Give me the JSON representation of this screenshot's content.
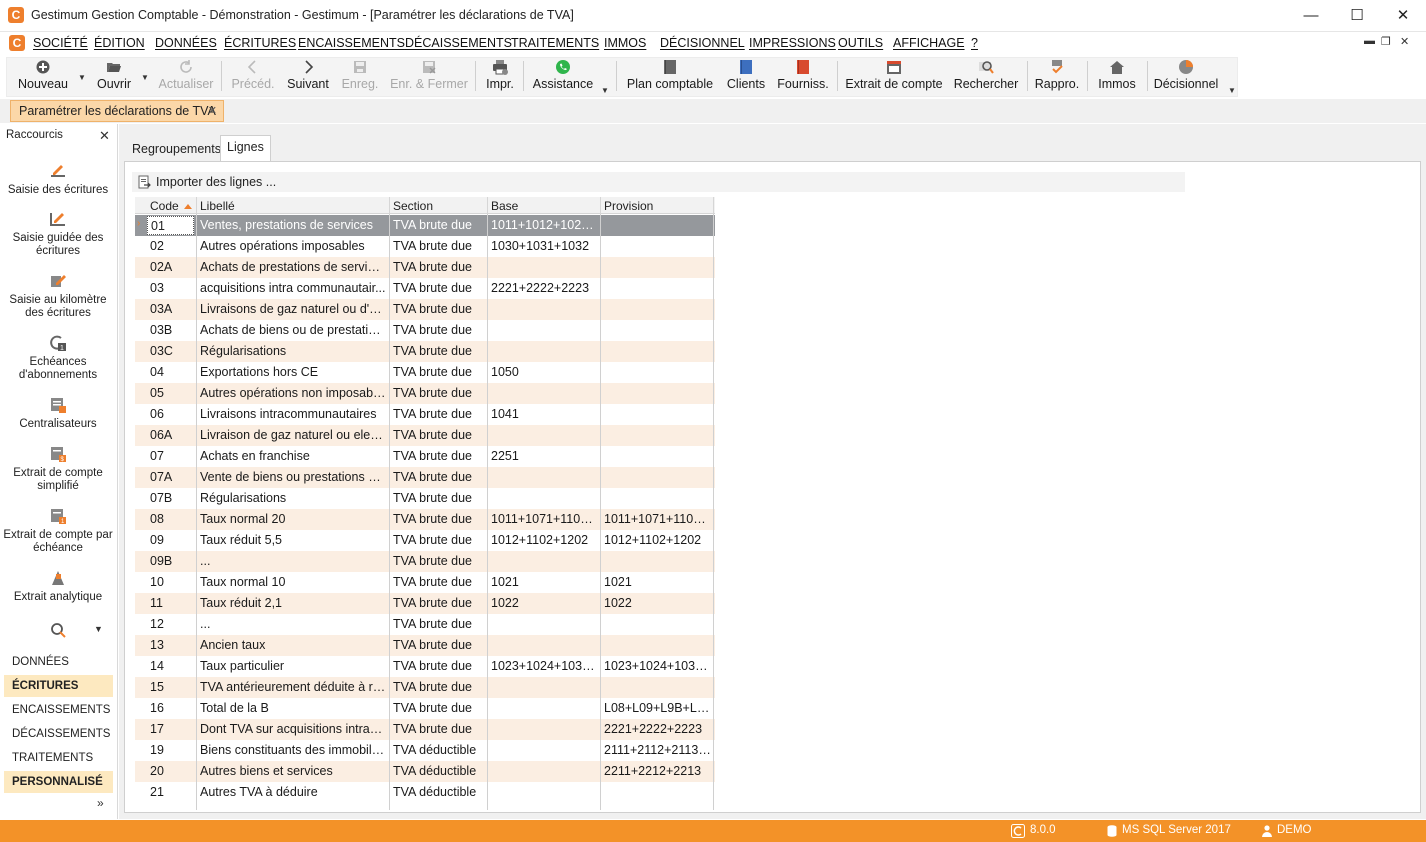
{
  "window": {
    "title": "Gestimum Gestion Comptable - Démonstration - Gestimum - [Paramétrer les déclarations de TVA]",
    "logo": "C",
    "minimize": "—",
    "maximize": "☐",
    "close": "✕"
  },
  "menu": {
    "items": [
      "SOCIÉTÉ",
      "ÉDITION",
      "DONNÉES",
      "ÉCRITURES",
      "ENCAISSEMENTS",
      "DÉCAISSEMENTS",
      "TRAITEMENTS",
      "IMMOS",
      "DÉCISIONNEL",
      "IMPRESSIONS",
      "OUTILS",
      "AFFICHAGE",
      "?"
    ],
    "mdi_minimize": "▬",
    "mdi_restore": "❐",
    "mdi_close": "✕"
  },
  "toolbar": {
    "nouveau": "Nouveau",
    "ouvrir": "Ouvrir",
    "actualiser": "Actualiser",
    "preced": "Précéd.",
    "suivant": "Suivant",
    "enreg": "Enreg.",
    "enr_fermer": "Enr. & Fermer",
    "impr": "Impr.",
    "assistance": "Assistance",
    "plan_comptable": "Plan comptable",
    "clients": "Clients",
    "fourniss": "Fourniss.",
    "extrait_compte": "Extrait de compte",
    "rechercher": "Rechercher",
    "rappro": "Rappro.",
    "immos": "Immos",
    "decisionnel": "Décisionnel"
  },
  "document_tab": {
    "label": "Paramétrer les déclarations de TVA",
    "close": "✕"
  },
  "sidebar": {
    "header": "Raccourcis",
    "close": "✕",
    "shortcuts": [
      "Saisie des écritures",
      "Saisie guidée des écritures",
      "Saisie au kilomètre des écritures",
      "Echéances d'abonnements",
      "Centralisateurs",
      "Extrait de compte simplifié",
      "Extrait de compte par échéance",
      "Extrait analytique"
    ],
    "nav": [
      "DONNÉES",
      "ÉCRITURES",
      "ENCAISSEMENTS",
      "DÉCAISSEMENTS",
      "TRAITEMENTS",
      "PERSONNALISÉ"
    ],
    "more": "»"
  },
  "tabs": {
    "regroupements": "Regroupements",
    "lignes": "Lignes"
  },
  "import_label": "Importer des lignes ...",
  "grid": {
    "columns": [
      "Code",
      "Libellé",
      "Section",
      "Base",
      "Provision"
    ],
    "rows": [
      [
        "01",
        "Ventes, prestations de services",
        "TVA brute due",
        "1011+1012+1021+...",
        ""
      ],
      [
        "02",
        "Autres opérations imposables",
        "TVA brute due",
        "1030+1031+1032",
        ""
      ],
      [
        "02A",
        "Achats de prestations de services ...",
        "TVA brute due",
        "",
        ""
      ],
      [
        "03",
        "acquisitions intra communautair...",
        "TVA brute due",
        "2221+2222+2223",
        ""
      ],
      [
        "03A",
        "Livraisons de gaz naturel ou d'éle...",
        "TVA brute due",
        "",
        ""
      ],
      [
        "03B",
        "Achats de biens ou de prestation...",
        "TVA brute due",
        "",
        ""
      ],
      [
        "03C",
        "Régularisations",
        "TVA brute due",
        "",
        ""
      ],
      [
        "04",
        "Exportations hors CE",
        "TVA brute due",
        "1050",
        ""
      ],
      [
        "05",
        "Autres opérations non imposables",
        "TVA brute due",
        "",
        ""
      ],
      [
        "06",
        "Livraisons intracommunautaires",
        "TVA brute due",
        "1041",
        ""
      ],
      [
        "06A",
        "Livraison de gaz naturel ou electri...",
        "TVA brute due",
        "",
        ""
      ],
      [
        "07",
        "Achats en franchise",
        "TVA brute due",
        "2251",
        ""
      ],
      [
        "07A",
        "Vente de biens ou prestations de ...",
        "TVA brute due",
        "",
        ""
      ],
      [
        "07B",
        "Régularisations",
        "TVA brute due",
        "",
        ""
      ],
      [
        "08",
        "Taux normal 20",
        "TVA brute due",
        "1011+1071+1101+...",
        "1011+1071+1101+..."
      ],
      [
        "09",
        "Taux réduit 5,5",
        "TVA brute due",
        "1012+1102+1202",
        "1012+1102+1202"
      ],
      [
        "09B",
        "...",
        "TVA brute due",
        "",
        ""
      ],
      [
        "10",
        "Taux normal 10",
        "TVA brute due",
        "1021",
        "1021"
      ],
      [
        "11",
        "Taux réduit 2,1",
        "TVA brute due",
        "1022",
        "1022"
      ],
      [
        "12",
        "...",
        "TVA brute due",
        "",
        ""
      ],
      [
        "13",
        "Ancien taux",
        "TVA brute due",
        "",
        ""
      ],
      [
        "14",
        "Taux particulier",
        "TVA brute due",
        "1023+1024+1031+...",
        "1023+1024+1031+..."
      ],
      [
        "15",
        "TVA antérieurement déduite à rev...",
        "TVA brute due",
        "",
        ""
      ],
      [
        "16",
        "Total de la B",
        "TVA brute due",
        "",
        "L08+L09+L9B+L1..."
      ],
      [
        "17",
        "Dont TVA sur acquisitions intraco...",
        "TVA brute due",
        "",
        "2221+2222+2223"
      ],
      [
        "19",
        "Biens constituants des immobilis...",
        "TVA déductible",
        "",
        "2111+2112+2113+..."
      ],
      [
        "20",
        "Autres biens et services",
        "TVA déductible",
        "",
        "2211+2212+2213"
      ],
      [
        "21",
        "Autres TVA à déduire",
        "TVA déductible",
        "",
        ""
      ]
    ]
  },
  "status": {
    "version": "8.0.0",
    "server": "MS SQL Server 2017",
    "user": "DEMO"
  },
  "colors": {
    "accent": "#f39228",
    "selected_row": "#95989c",
    "alt_row": "#fbeee2"
  }
}
